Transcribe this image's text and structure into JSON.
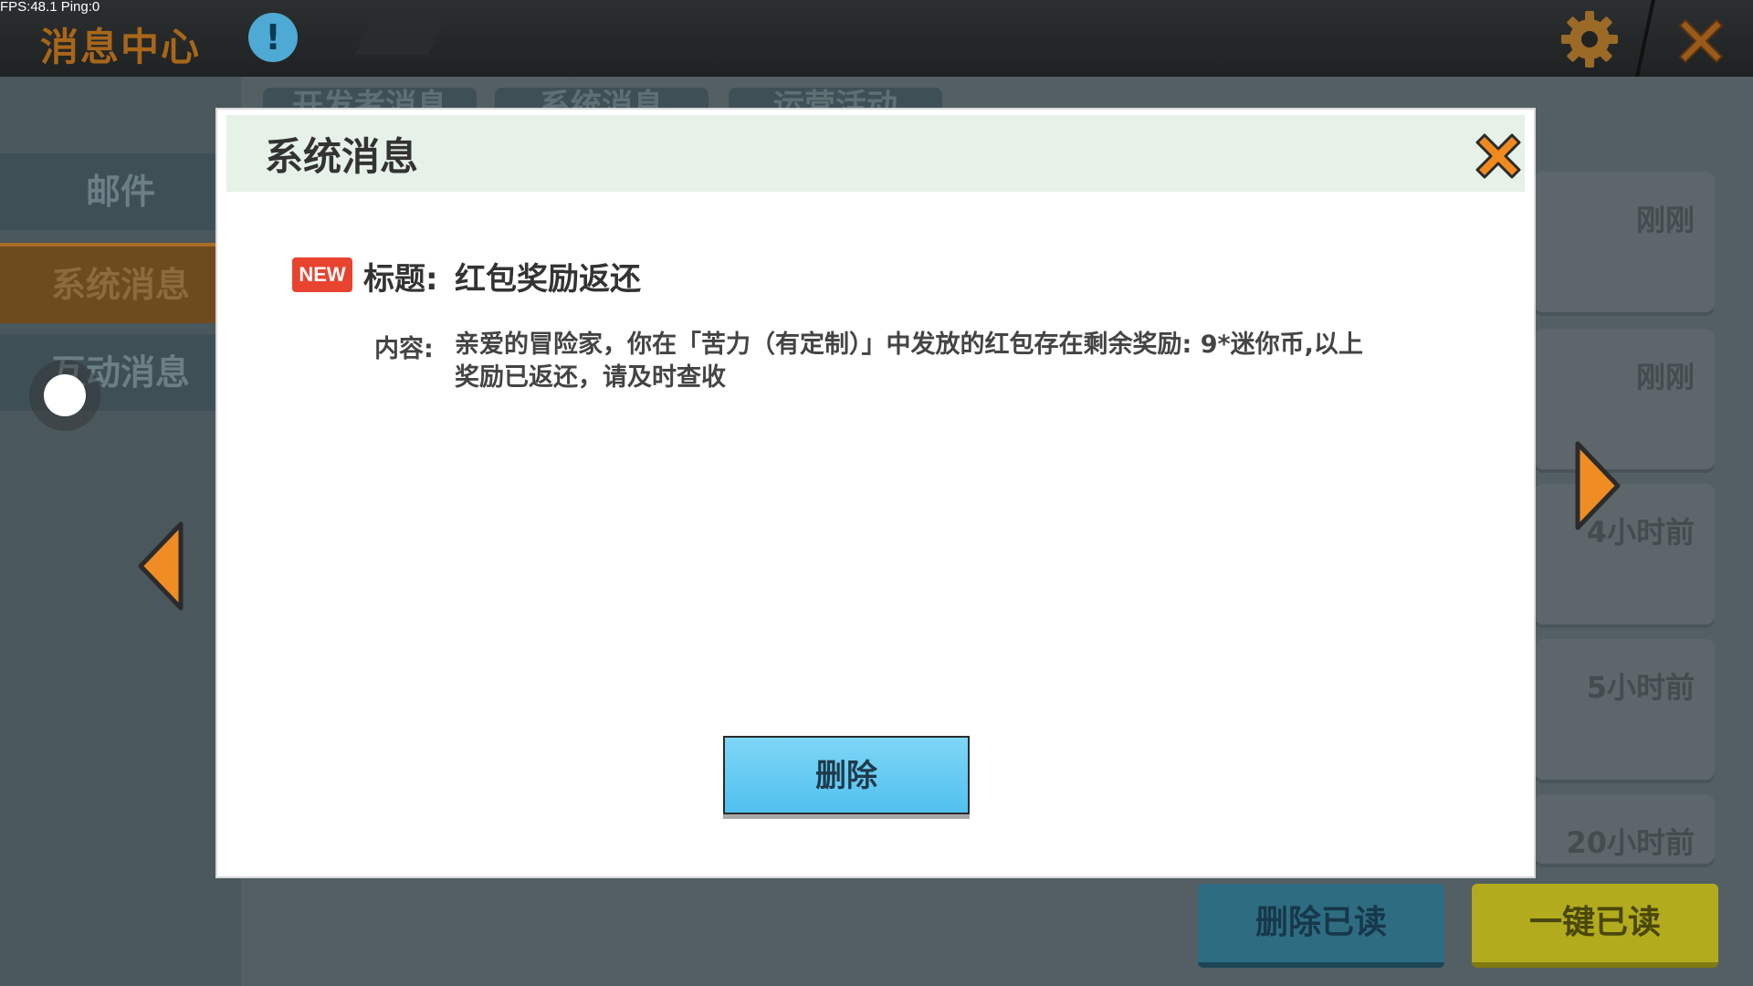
{
  "debug": {
    "fps_text": "FPS:48.1  Ping:0"
  },
  "header": {
    "title": "消息中心",
    "info_symbol": "!",
    "colors": {
      "title": "#a8661a",
      "info": "#4ea9d4",
      "accent": "#e7861c"
    }
  },
  "sidebar": {
    "items": [
      {
        "label": "邮件",
        "active": false
      },
      {
        "label": "系统消息",
        "active": true
      },
      {
        "label": "互动消息",
        "active": false
      }
    ]
  },
  "tabs": [
    {
      "label": "开发者消息"
    },
    {
      "label": "系统消息"
    },
    {
      "label": "运营活动"
    }
  ],
  "list": {
    "items": [
      {
        "time": "刚刚"
      },
      {
        "time": "刚刚"
      },
      {
        "time": "4小时前"
      },
      {
        "time": "5小时前"
      },
      {
        "time": "20小时前"
      }
    ]
  },
  "actions": {
    "delete_read": "删除已读",
    "mark_all_read": "一键已读"
  },
  "modal": {
    "title": "系统消息",
    "new_badge": "NEW",
    "title_label": "标题:",
    "title_value": "红包奖励返还",
    "content_label": "内容:",
    "content_value": "亲爱的冒险家，你在「苦力（有定制）」中发放的红包存在剩余奖励: 9*迷你币,以上奖励已返还，请及时查收",
    "delete_label": "删除"
  }
}
